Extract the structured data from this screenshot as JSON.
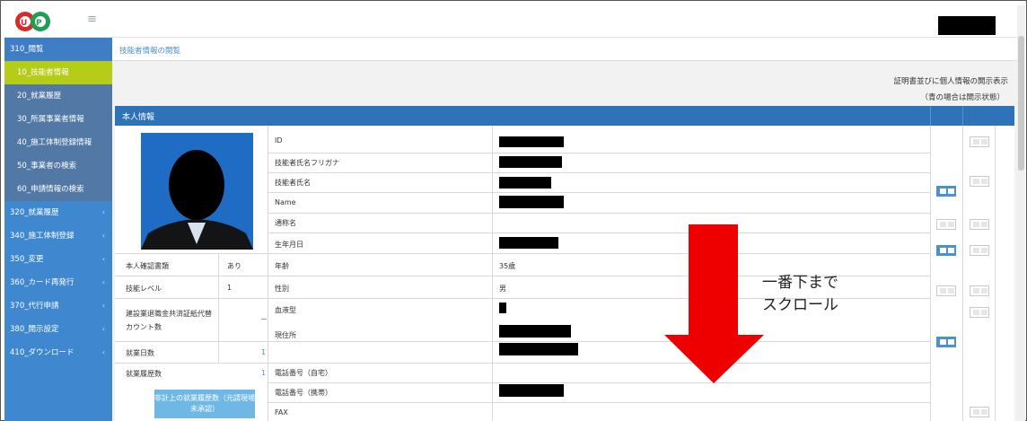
{
  "header": {
    "logo_letters": "UCP",
    "menu_icon": "hamburger-icon"
  },
  "breadcrumb": "技能者情報の閲覧",
  "sidebar": {
    "items": [
      {
        "label": "310_閲覧",
        "type": "parent-open"
      },
      {
        "label": "10_技能者情報",
        "type": "child",
        "active": true
      },
      {
        "label": "20_就業履歴",
        "type": "child"
      },
      {
        "label": "30_所属事業者情報",
        "type": "child"
      },
      {
        "label": "40_施工体制登録情報",
        "type": "child"
      },
      {
        "label": "50_事業者の検索",
        "type": "child"
      },
      {
        "label": "60_申請情報の検索",
        "type": "child"
      },
      {
        "label": "320_就業履歴",
        "type": "parent"
      },
      {
        "label": "340_施工体制登録",
        "type": "parent"
      },
      {
        "label": "350_変更",
        "type": "parent"
      },
      {
        "label": "360_カード再発行",
        "type": "parent"
      },
      {
        "label": "370_代行申請",
        "type": "parent"
      },
      {
        "label": "380_開示設定",
        "type": "parent"
      },
      {
        "label": "410_ダウンロード",
        "type": "parent"
      }
    ]
  },
  "disclosure": {
    "title": "証明書並びに個人情報の開示表示",
    "subtitle": "（青の場合は開示状態）"
  },
  "panel": {
    "title": "本人情報"
  },
  "left_fields": [
    {
      "label": "本人確認書類",
      "value": "あり"
    },
    {
      "label": "技能レベル",
      "value": "1"
    },
    {
      "label": "建設業退職金共済証紙代替カウント数",
      "value": "－"
    },
    {
      "label": "就業日数",
      "value": "1"
    },
    {
      "label": "就業履歴数",
      "value": "1"
    }
  ],
  "history_button": "非計上の就業履歴数（元請現場未承認）",
  "fields": [
    {
      "label": "ID",
      "value": ""
    },
    {
      "label": "技能者氏名フリガナ",
      "value": ""
    },
    {
      "label": "技能者氏名",
      "value": ""
    },
    {
      "label": "Name",
      "value": ""
    },
    {
      "label": "通称名",
      "value": ""
    },
    {
      "label": "生年月日",
      "value": ""
    },
    {
      "label": "年齢",
      "value": "35歳"
    },
    {
      "label": "性別",
      "value": "男"
    },
    {
      "label": "血液型",
      "value": ""
    },
    {
      "label": "現住所",
      "value": ""
    },
    {
      "label": "電話番号（自宅）",
      "value": ""
    },
    {
      "label": "電話番号（携帯）",
      "value": ""
    },
    {
      "label": "FAX",
      "value": ""
    }
  ],
  "annotation": "一番下まで\nスクロール",
  "colors": {
    "sidebar": "#3f88d0",
    "active": "#b5cc18",
    "header": "#2e73b8",
    "arrow": "#ee0000"
  }
}
